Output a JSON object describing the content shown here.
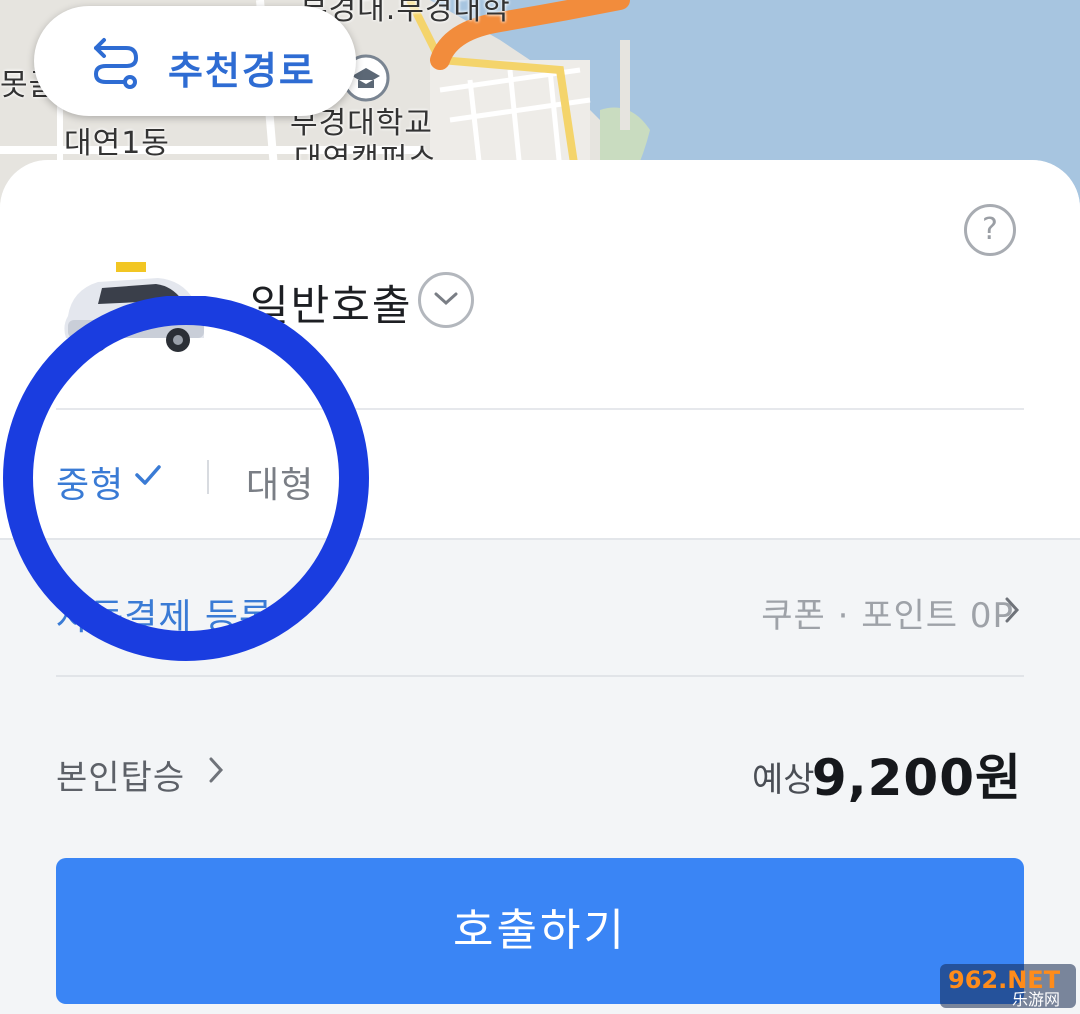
{
  "map": {
    "labels": {
      "district": "대연1동",
      "university": "부경대학교",
      "campus": "대연캠퍼스",
      "top_label": "부경대.부경대학",
      "left_partial": "못골"
    },
    "colors": {
      "water": "#a7c5e0",
      "route": "#f28c3c",
      "road": "#f4d46b"
    }
  },
  "route_button": {
    "label": "추천경로",
    "icon": "route-icon"
  },
  "sheet": {
    "help_icon": "?",
    "service": {
      "name": "일반호출",
      "icon": "taxi-icon"
    },
    "size_options": [
      {
        "label": "중형",
        "selected": true
      },
      {
        "label": "대형",
        "selected": false
      }
    ],
    "payment": {
      "register_label": "자동결제 등록",
      "coupon_label": "쿠폰 · 포인트 0P"
    },
    "self_boarding": "본인탑승",
    "fare": {
      "prefix": "예상",
      "amount": "9,200원"
    },
    "call_button": "호출하기"
  },
  "watermark": {
    "brand": "962.NET",
    "sub": "乐游网"
  },
  "colors": {
    "accent": "#3a85f5",
    "selected_text": "#3a7bd5",
    "annotation_circle": "#1a3de0"
  }
}
